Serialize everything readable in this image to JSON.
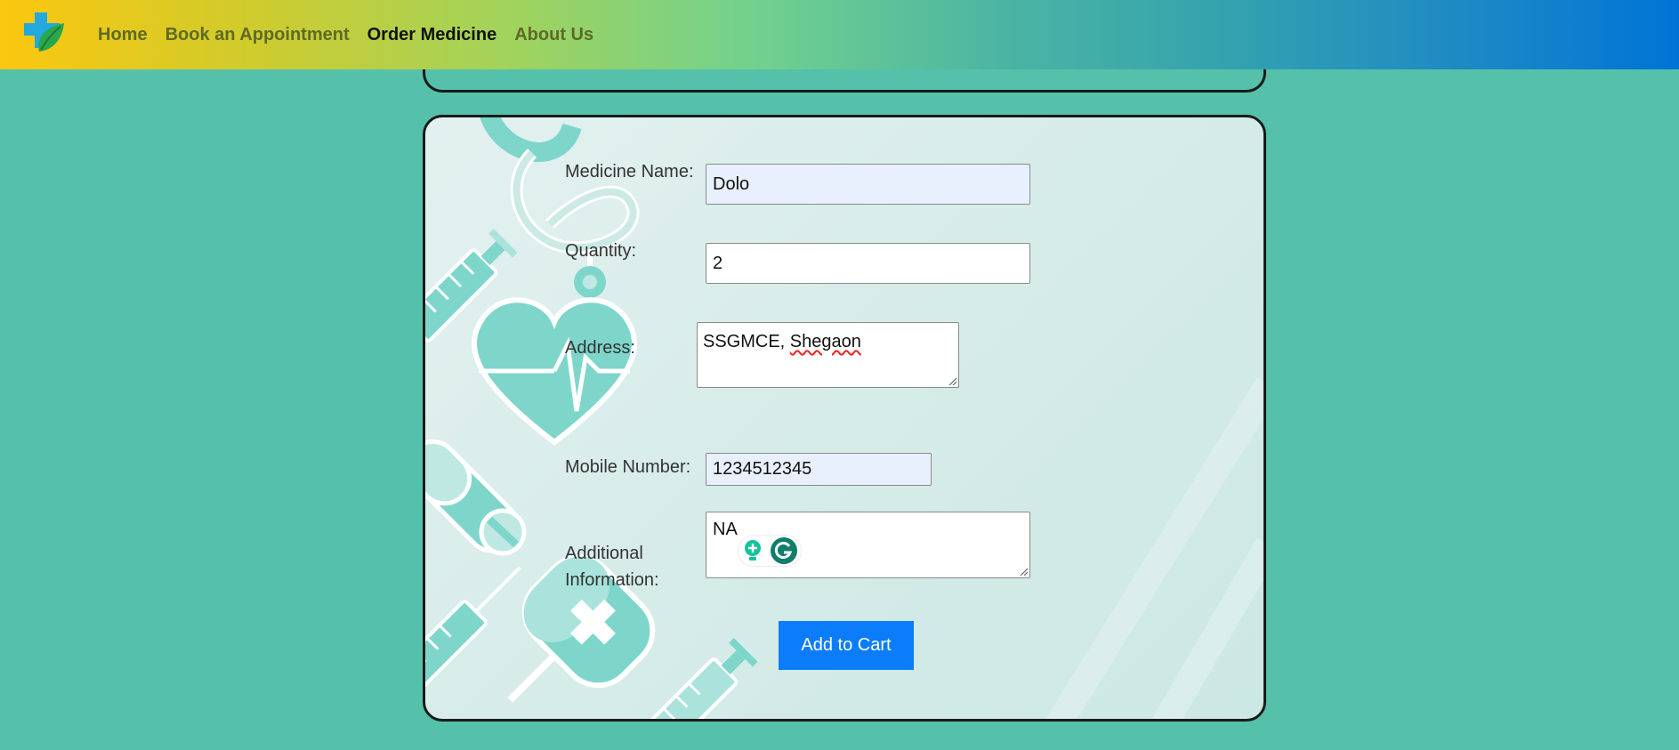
{
  "nav": {
    "links": [
      "Home",
      "Book an Appointment",
      "Order Medicine",
      "About Us"
    ],
    "active": "Order Medicine"
  },
  "form": {
    "medicine_name_label": "Medicine Name:",
    "medicine_name_value": "Dolo",
    "quantity_label": "Quantity:",
    "quantity_value": "2",
    "address_label": "Address:",
    "address_value_part1": "SSGMCE, ",
    "address_value_part2": "Shegaon",
    "mobile_label": "Mobile Number:",
    "mobile_value": "1234512345",
    "additional_label_line1": "Additional",
    "additional_label_line2": "Information:",
    "additional_value": "NA",
    "submit_label": "Add to Cart"
  },
  "colors": {
    "page_bg": "#56c1aa",
    "button": "#0b7dfb",
    "autofill_bg": "#e8f0fe"
  },
  "icons": [
    "medical-cross-leaf-logo-icon",
    "stethoscope-icon",
    "syringe-icon",
    "heart-pulse-icon",
    "pill-capsule-icon",
    "pill-tablet-icon",
    "iv-bag-icon",
    "grammarly-suggestion-icon",
    "grammarly-logo-icon"
  ]
}
